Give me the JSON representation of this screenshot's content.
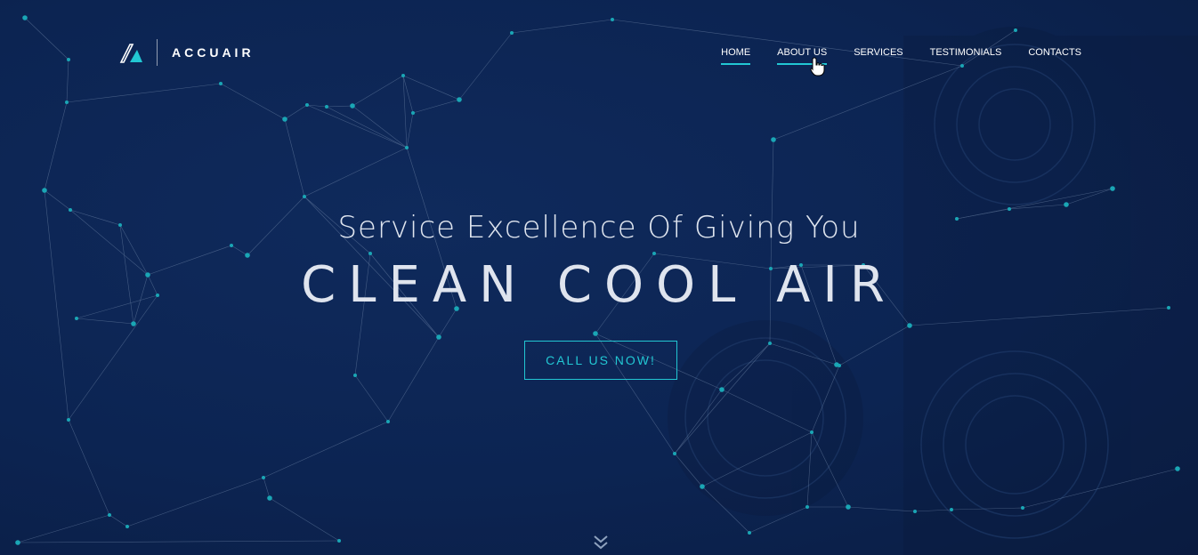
{
  "brand": {
    "name": "ACCUAIR",
    "logo_icon": "accuair-logo-icon"
  },
  "nav": {
    "items": [
      {
        "label": "HOME",
        "state": "active"
      },
      {
        "label": "ABOUT US",
        "state": "hover"
      },
      {
        "label": "SERVICES",
        "state": ""
      },
      {
        "label": "TESTIMONIALS",
        "state": ""
      },
      {
        "label": "CONTACTS",
        "state": ""
      }
    ]
  },
  "hero": {
    "subtitle": "Service Excellence Of Giving You",
    "title": "CLEAN COOL AIR",
    "cta_label": "CALL US NOW!"
  },
  "icons": {
    "scroll": "chevrons-down-icon",
    "cursor": "hand-pointer-icon"
  },
  "colors": {
    "accent": "#22c7d3",
    "background": "#0c2452",
    "text": "#ffffff"
  }
}
